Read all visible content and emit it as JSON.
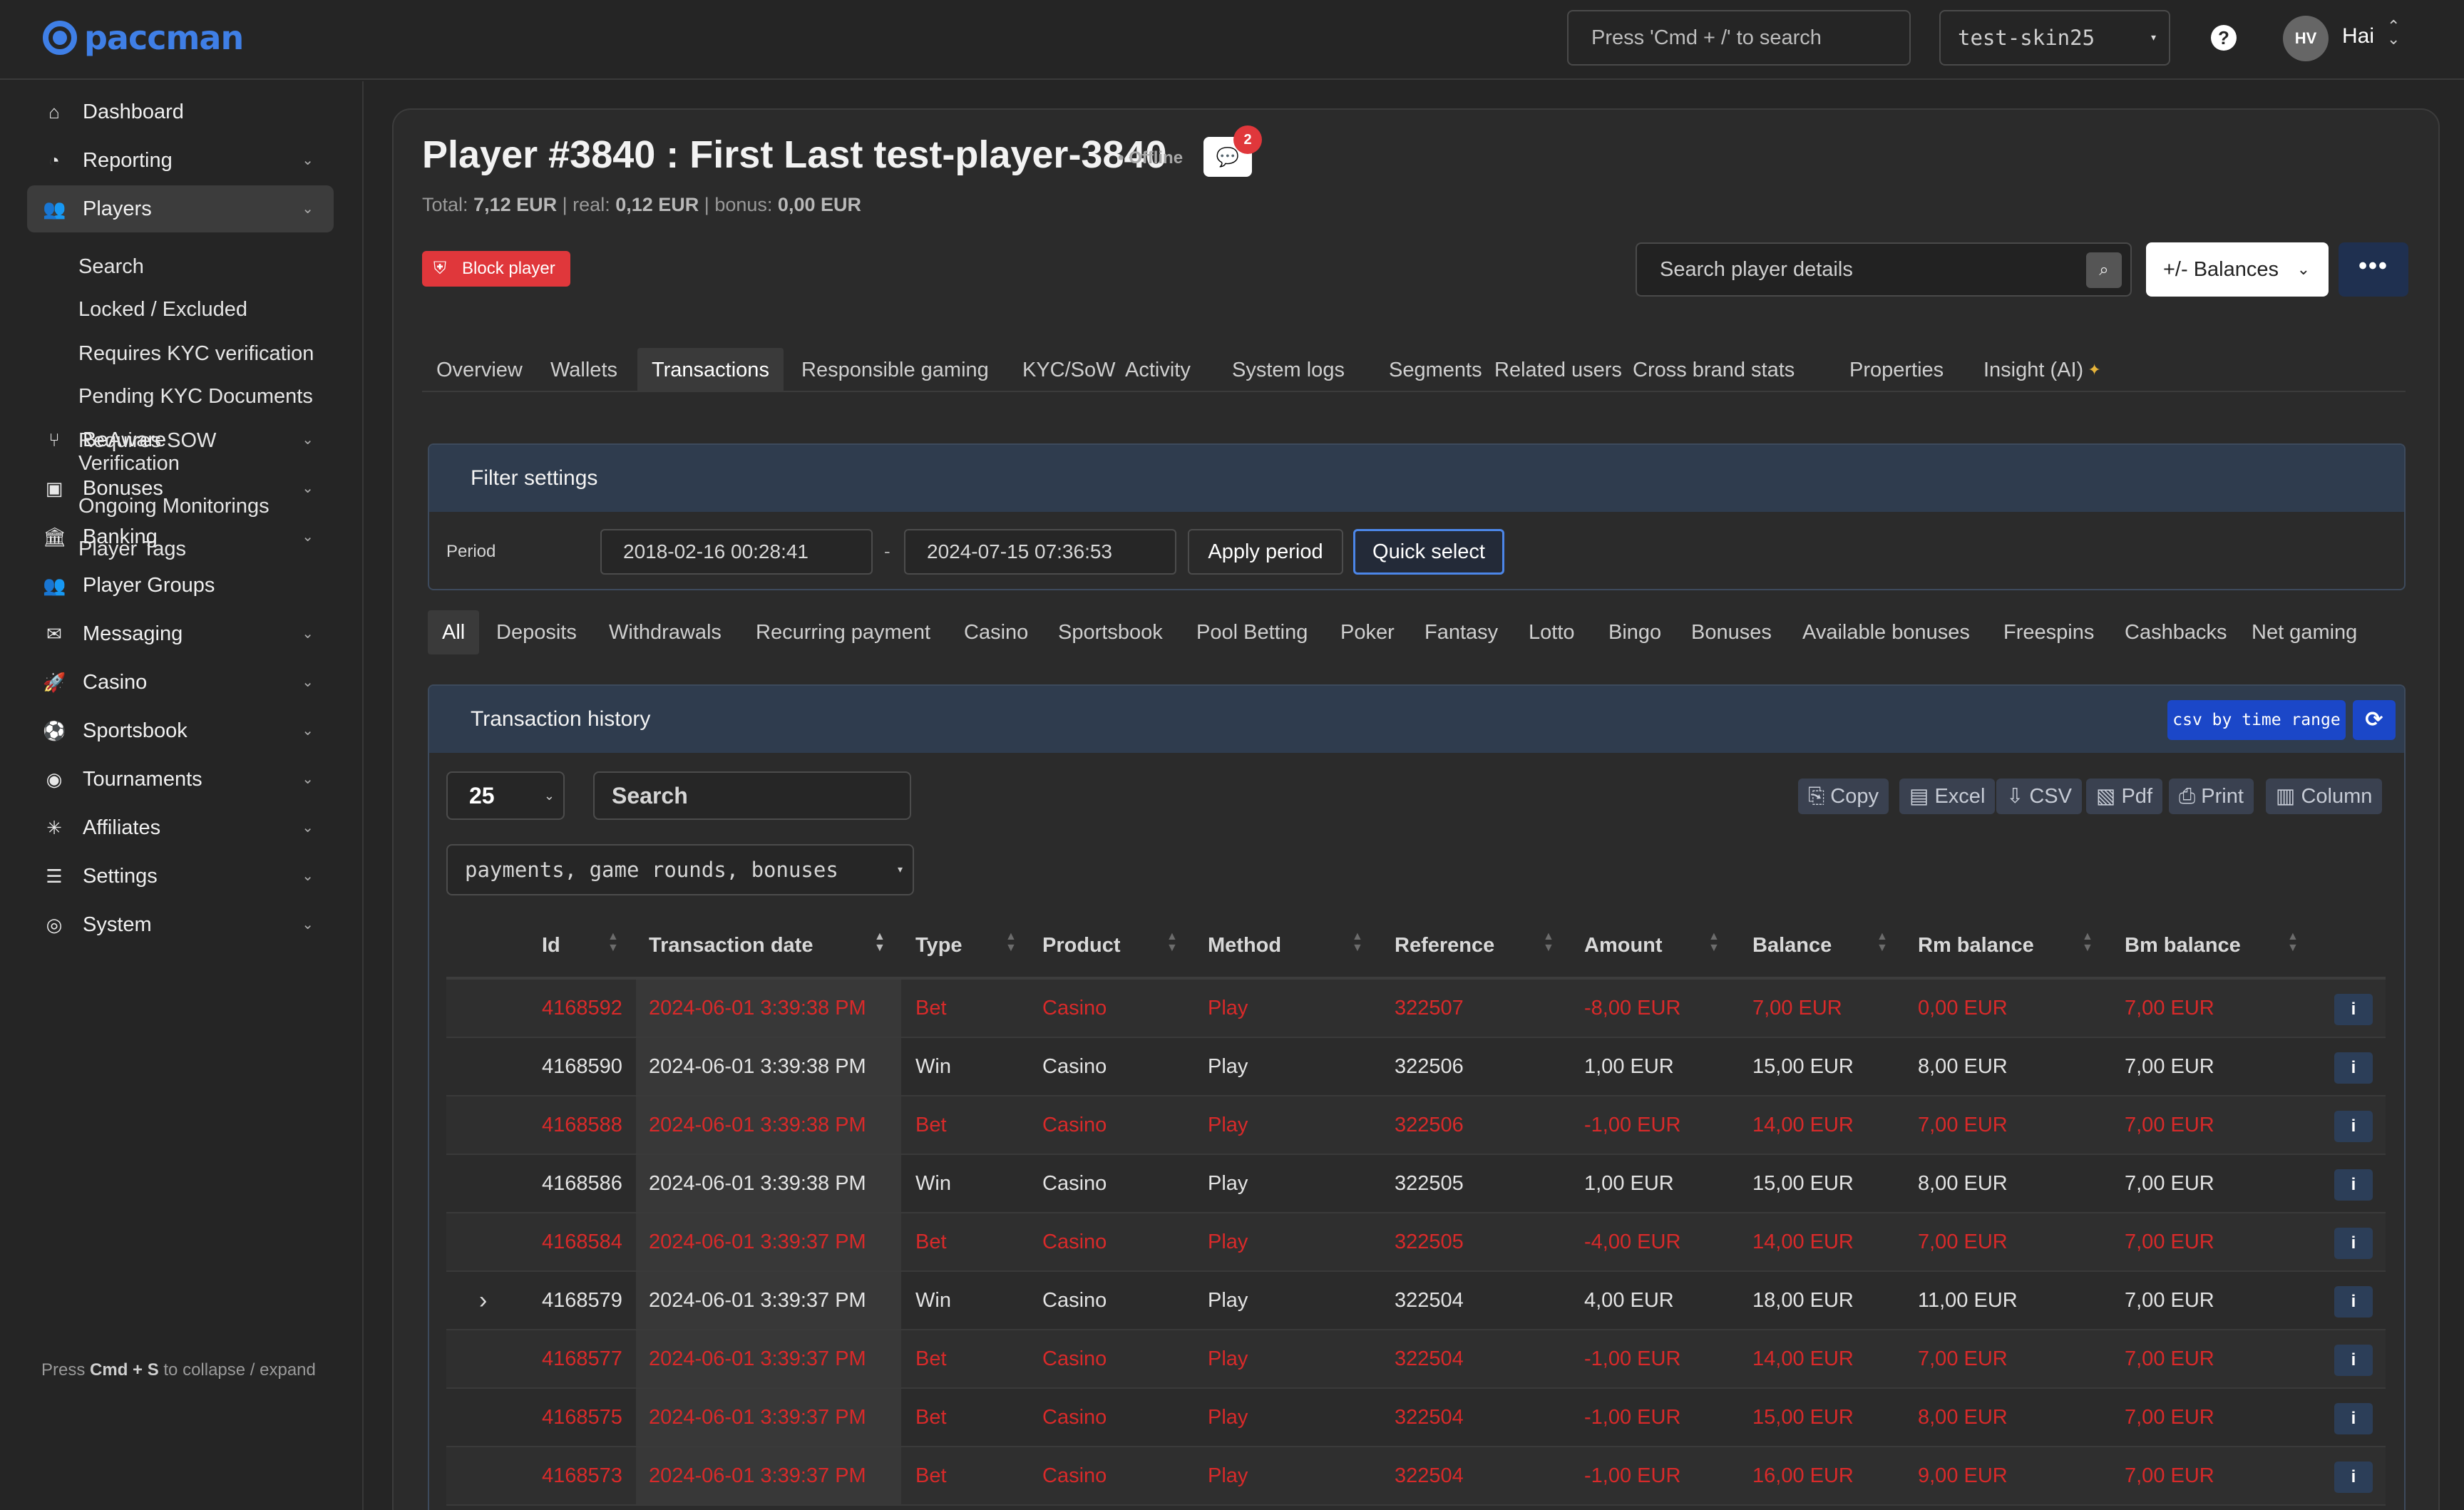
{
  "brand": {
    "name": "paccman",
    "color": "#3f7fe6"
  },
  "topbar": {
    "search_placeholder": "Press 'Cmd + /' to search",
    "skin": "test-skin25",
    "help_icon": "?",
    "user_initials": "HV",
    "user_name": "Hai"
  },
  "sidebar": {
    "items": [
      {
        "label": "Dashboard",
        "icon": "home-icon",
        "glyph": "⌂",
        "chevron": false
      },
      {
        "label": "Reporting",
        "icon": "pie-chart-icon",
        "glyph": "◔",
        "chevron": true
      },
      {
        "label": "Players",
        "icon": "users-icon",
        "glyph": "👥",
        "chevron": true,
        "active": true
      },
      {
        "label": "BeAware",
        "icon": "fork-icon",
        "glyph": "⑂",
        "chevron": true
      },
      {
        "label": "Bonuses",
        "icon": "ticket-icon",
        "glyph": "▣",
        "chevron": true
      },
      {
        "label": "Banking",
        "icon": "bank-icon",
        "glyph": "🏛",
        "chevron": true
      },
      {
        "label": "Player Groups",
        "icon": "group-icon",
        "glyph": "👥",
        "chevron": false
      },
      {
        "label": "Messaging",
        "icon": "envelope-icon",
        "glyph": "✉",
        "chevron": true
      },
      {
        "label": "Casino",
        "icon": "rocket-icon",
        "glyph": "🚀",
        "chevron": true
      },
      {
        "label": "Sportsbook",
        "icon": "ball-icon",
        "glyph": "⚽",
        "chevron": true
      },
      {
        "label": "Tournaments",
        "icon": "trophy-icon",
        "glyph": "◉",
        "chevron": true
      },
      {
        "label": "Affiliates",
        "icon": "affiliates-icon",
        "glyph": "✳",
        "chevron": true
      },
      {
        "label": "Settings",
        "icon": "sliders-icon",
        "glyph": "☰",
        "chevron": true
      },
      {
        "label": "System",
        "icon": "system-icon",
        "glyph": "◎",
        "chevron": true
      }
    ],
    "player_subitems": [
      "Search",
      "Locked / Excluded",
      "Requires KYC verification",
      "Pending KYC Documents",
      "Requires SOW",
      "Verification",
      "Ongoing Monitorings",
      "Player Tags"
    ],
    "collapse_hint_prefix": "Press ",
    "collapse_hint_keys": "Cmd + S",
    "collapse_hint_suffix": " to collapse / expand"
  },
  "player": {
    "title": "Player #3840 : First Last test-player-3840",
    "status": "• Offline",
    "unread_messages": "2",
    "totals": {
      "total_label": "Total:",
      "total": "7,12 EUR",
      "sep1": "|",
      "real_label": "real:",
      "real": "0,12 EUR",
      "sep2": "|",
      "bonus_label": "bonus:",
      "bonus": "0,00 EUR"
    },
    "block_button": "Block player",
    "details_search_placeholder": "Search player details",
    "balances_button": "+/- Balances",
    "more_button": "•••"
  },
  "tabs": [
    "Overview",
    "Wallets",
    "Transactions",
    "Responsible gaming",
    "KYC/SoW",
    "Activity",
    "System logs",
    "Segments",
    "Related users",
    "Cross brand stats",
    "Properties",
    "Insight (AI)"
  ],
  "active_tab": "Transactions",
  "filter": {
    "title": "Filter settings",
    "period_label": "Period",
    "from": "2018-02-16 00:28:41",
    "separator": "-",
    "to": "2024-07-15 07:36:53",
    "apply_button": "Apply period",
    "quick_select_button": "Quick select"
  },
  "subtabs": [
    "All",
    "Deposits",
    "Withdrawals",
    "Recurring payment",
    "Casino",
    "Sportsbook",
    "Pool Betting",
    "Poker",
    "Fantasy",
    "Lotto",
    "Bingo",
    "Bonuses",
    "Available bonuses",
    "Freespins",
    "Cashbacks",
    "Net gaming"
  ],
  "transactions": {
    "title": "Transaction history",
    "csv_button": "csv by time range",
    "page_length": "25",
    "search_placeholder": "Search",
    "type_filter": "payments, game rounds, bonuses",
    "toolbar": [
      "Copy",
      "Excel",
      "CSV",
      "Pdf",
      "Print",
      "Column"
    ],
    "columns": [
      "Id",
      "Transaction date",
      "Type",
      "Product",
      "Method",
      "Reference",
      "Amount",
      "Balance",
      "Rm balance",
      "Bm balance"
    ],
    "info_label": "i",
    "rows": [
      {
        "id": "4168592",
        "date": "2024-06-01 3:39:38 PM",
        "type": "Bet",
        "product": "Casino",
        "method": "Play",
        "reference": "322507",
        "amount": "-8,00 EUR",
        "balance": "7,00 EUR",
        "rm": "0,00 EUR",
        "bm": "7,00 EUR",
        "bet": true
      },
      {
        "id": "4168590",
        "date": "2024-06-01 3:39:38 PM",
        "type": "Win",
        "product": "Casino",
        "method": "Play",
        "reference": "322506",
        "amount": "1,00 EUR",
        "balance": "15,00 EUR",
        "rm": "8,00 EUR",
        "bm": "7,00 EUR",
        "bet": false
      },
      {
        "id": "4168588",
        "date": "2024-06-01 3:39:38 PM",
        "type": "Bet",
        "product": "Casino",
        "method": "Play",
        "reference": "322506",
        "amount": "-1,00 EUR",
        "balance": "14,00 EUR",
        "rm": "7,00 EUR",
        "bm": "7,00 EUR",
        "bet": true
      },
      {
        "id": "4168586",
        "date": "2024-06-01 3:39:38 PM",
        "type": "Win",
        "product": "Casino",
        "method": "Play",
        "reference": "322505",
        "amount": "1,00 EUR",
        "balance": "15,00 EUR",
        "rm": "8,00 EUR",
        "bm": "7,00 EUR",
        "bet": false
      },
      {
        "id": "4168584",
        "date": "2024-06-01 3:39:37 PM",
        "type": "Bet",
        "product": "Casino",
        "method": "Play",
        "reference": "322505",
        "amount": "-4,00 EUR",
        "balance": "14,00 EUR",
        "rm": "7,00 EUR",
        "bm": "7,00 EUR",
        "bet": true
      },
      {
        "id": "4168579",
        "date": "2024-06-01 3:39:37 PM",
        "type": "Win",
        "product": "Casino",
        "method": "Play",
        "reference": "322504",
        "amount": "4,00 EUR",
        "balance": "18,00 EUR",
        "rm": "11,00 EUR",
        "bm": "7,00 EUR",
        "bet": false,
        "expandable": true
      },
      {
        "id": "4168577",
        "date": "2024-06-01 3:39:37 PM",
        "type": "Bet",
        "product": "Casino",
        "method": "Play",
        "reference": "322504",
        "amount": "-1,00 EUR",
        "balance": "14,00 EUR",
        "rm": "7,00 EUR",
        "bm": "7,00 EUR",
        "bet": true
      },
      {
        "id": "4168575",
        "date": "2024-06-01 3:39:37 PM",
        "type": "Bet",
        "product": "Casino",
        "method": "Play",
        "reference": "322504",
        "amount": "-1,00 EUR",
        "balance": "15,00 EUR",
        "rm": "8,00 EUR",
        "bm": "7,00 EUR",
        "bet": true
      },
      {
        "id": "4168573",
        "date": "2024-06-01 3:39:37 PM",
        "type": "Bet",
        "product": "Casino",
        "method": "Play",
        "reference": "322504",
        "amount": "-1,00 EUR",
        "balance": "16,00 EUR",
        "rm": "9,00 EUR",
        "bm": "7,00 EUR",
        "bet": true
      }
    ]
  },
  "colors": {
    "bet_red": "#d82a2a",
    "csv_blue": "#1b47c8",
    "block_red": "#e0373b",
    "panel_header": "#2f3c4e"
  }
}
